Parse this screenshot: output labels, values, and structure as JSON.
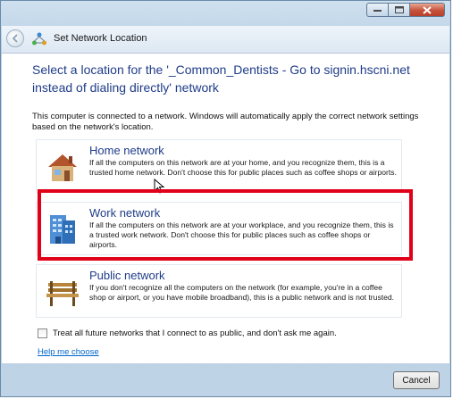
{
  "window": {
    "title": "Set Network Location"
  },
  "main": {
    "heading": "Select a location for the '_Common_Dentists - Go to signin.hscni.net instead of dialing directly' network",
    "intro": "This computer is connected to a network. Windows will automatically apply the correct network settings based on the network's location."
  },
  "options": [
    {
      "title": "Home network",
      "description": "If all the computers on this network are at your home, and you recognize them, this is a trusted home network.  Don't choose this for public places such as coffee shops or airports.",
      "icon": "house-icon"
    },
    {
      "title": "Work network",
      "description": "If all the computers on this network are at your workplace, and you recognize them, this is a trusted work network.  Don't choose this for public places such as coffee shops or airports.",
      "icon": "office-building-icon"
    },
    {
      "title": "Public network",
      "description": "If you don't recognize all the computers on the network (for example, you're in a coffee shop or airport, or you have mobile broadband), this is a public network and is not trusted.",
      "icon": "park-bench-icon"
    }
  ],
  "checkbox": {
    "label": "Treat all future networks that I connect to as public, and don't ask me again.",
    "checked": false
  },
  "help_link": "Help me choose",
  "buttons": {
    "cancel": "Cancel"
  },
  "colors": {
    "link": "#0066cc",
    "heading": "#1f3c88",
    "highlight": "#e1001a"
  }
}
